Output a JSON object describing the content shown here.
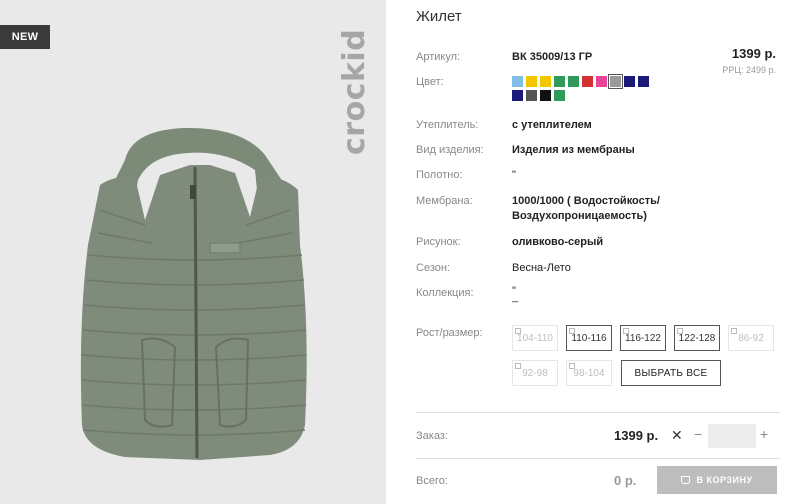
{
  "badge": "NEW",
  "brand": "crockid",
  "product": {
    "title": "Жилет",
    "price": "1399 р.",
    "rrc": "РРЦ: 2499 р."
  },
  "rows": {
    "article": {
      "label": "Артикул:",
      "value": "ВК 35009/13 ГР"
    },
    "color": {
      "label": "Цвет:"
    },
    "insulation": {
      "label": "Утеплитель:",
      "value": "с утеплителем"
    },
    "type": {
      "label": "Вид изделия:",
      "value": "Изделия из мембраны"
    },
    "fabric": {
      "label": "Полотно:",
      "value": "\""
    },
    "membrane": {
      "label": "Мембрана:",
      "value_line1": "1000/1000 ( Водостойкость/",
      "value_line2": "Воздухопроницаемость)"
    },
    "pattern": {
      "label": "Рисунок:",
      "value": "оливково-серый"
    },
    "season": {
      "label": "Сезон:",
      "value": "Весна-Лето"
    },
    "collection": {
      "label": "Коллекция:",
      "value": "\"",
      "value2": "_"
    },
    "size": {
      "label": "Рост/размер:"
    }
  },
  "swatches": [
    {
      "color": "#7fbfe8",
      "selected": false
    },
    {
      "color": "#f2c700",
      "selected": false
    },
    {
      "color": "#f2c700",
      "selected": false
    },
    {
      "color": "#2f9a5a",
      "selected": false
    },
    {
      "color": "#2f9a5a",
      "selected": false
    },
    {
      "color": "#d33030",
      "selected": false
    },
    {
      "color": "#e8459a",
      "selected": false
    },
    {
      "color": "#9a9a9a",
      "selected": true
    },
    {
      "color": "#1a1a7a",
      "selected": false
    },
    {
      "color": "#1a1a7a",
      "selected": false
    },
    {
      "color": "#1a1a7a",
      "selected": false
    },
    {
      "color": "#555555",
      "selected": false
    },
    {
      "color": "#111111",
      "selected": false
    },
    {
      "color": "#2f9a5a",
      "selected": false
    }
  ],
  "sizes": [
    {
      "label": "104-110",
      "state": "disabled"
    },
    {
      "label": "110-116",
      "state": "available"
    },
    {
      "label": "116-122",
      "state": "available"
    },
    {
      "label": "122-128",
      "state": "available"
    },
    {
      "label": "86-92",
      "state": "disabled"
    },
    {
      "label": "92-98",
      "state": "disabled"
    },
    {
      "label": "98-104",
      "state": "disabled"
    }
  ],
  "select_all": "ВЫБРАТЬ ВСЕ",
  "order": {
    "label": "Заказ:",
    "price": "1399 р.",
    "times": "✕",
    "minus": "−",
    "plus": "+",
    "quantity": ""
  },
  "total": {
    "label": "Всего:",
    "value": "0 р.",
    "cart_button": "В КОРЗИНУ"
  }
}
